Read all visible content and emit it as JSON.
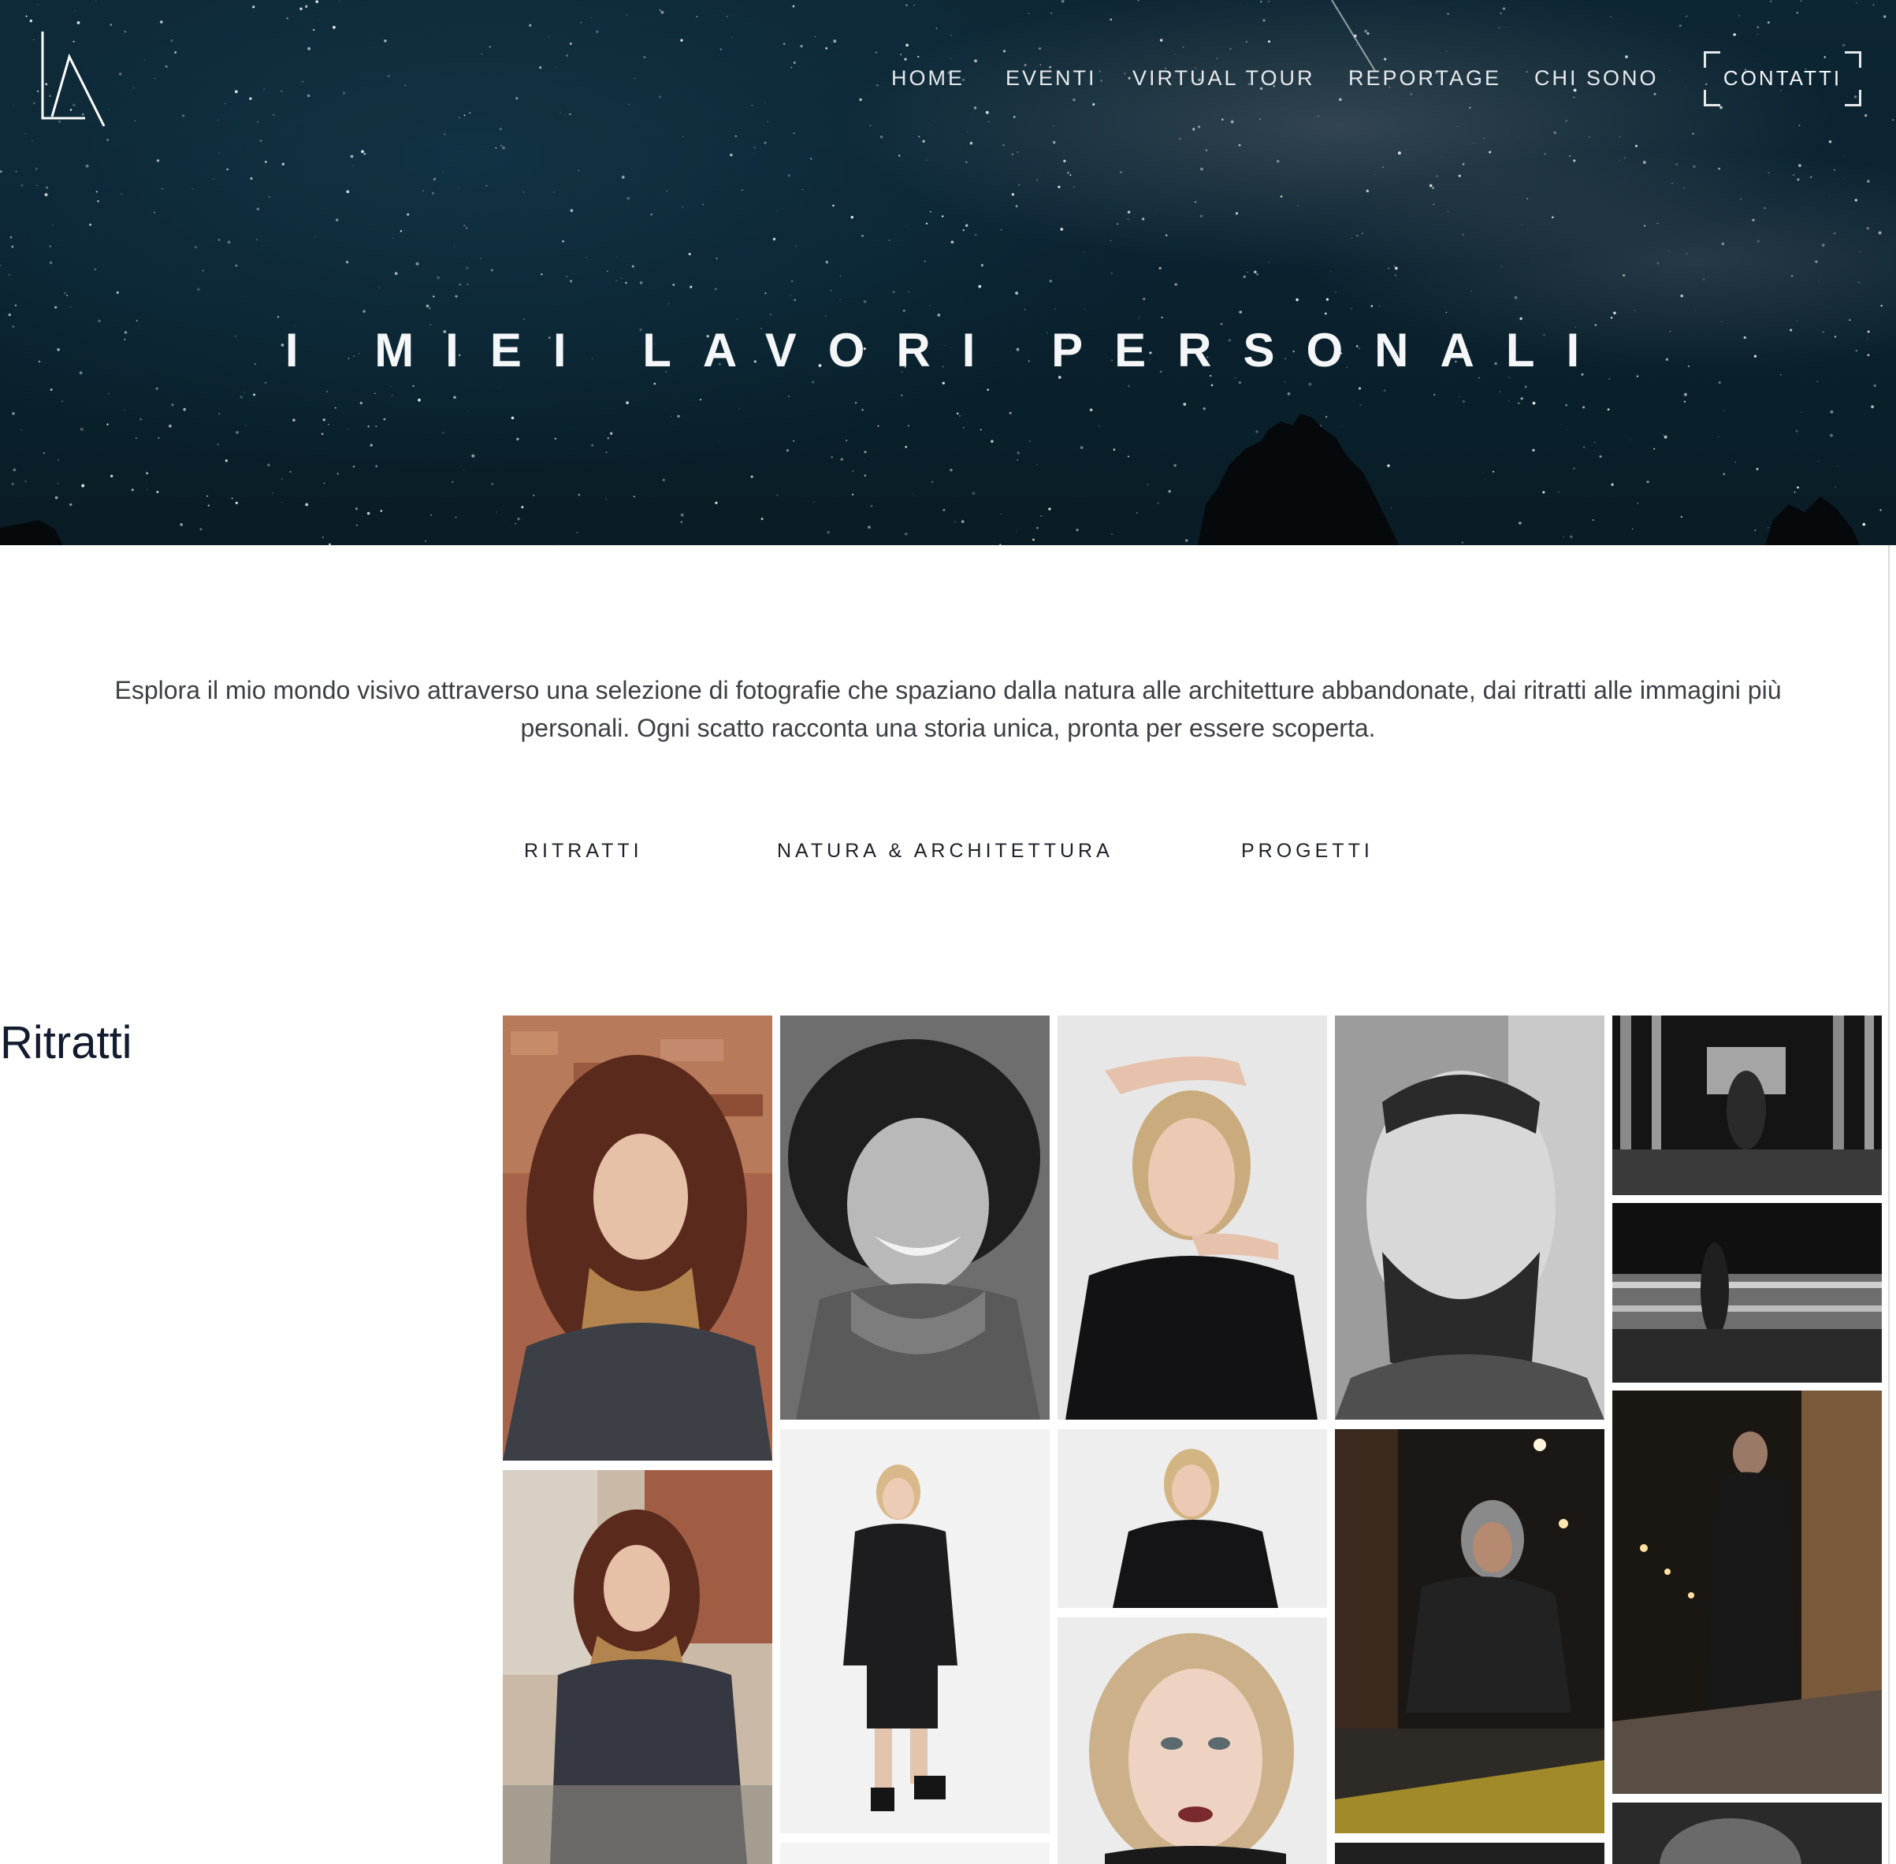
{
  "header": {
    "logo_alt": "LA",
    "nav": [
      {
        "label": "HOME"
      },
      {
        "label": "EVENTI"
      },
      {
        "label": "VIRTUAL TOUR"
      },
      {
        "label": "REPORTAGE"
      },
      {
        "label": "CHI SONO"
      }
    ],
    "contact_label": "CONTATTI"
  },
  "hero": {
    "title": "I MIEI LAVORI PERSONALI"
  },
  "intro": {
    "line1": "Esplora il mio mondo visivo attraverso una selezione di fotografie che spaziano dalla natura alle architetture abbandonate, dai ritratti alle immagini più",
    "line2": "personali. Ogni scatto racconta una storia unica, pronta per essere scoperta."
  },
  "filters": [
    {
      "label": "RITRATTI"
    },
    {
      "label": "NATURA & ARCHITETTURA"
    },
    {
      "label": "PROGETTI"
    }
  ],
  "gallery": {
    "title": "Ritratti"
  },
  "colors": {
    "hero_bg": "#0b2230",
    "nav_text": "#e6e9ec",
    "body_text": "#3c3f44",
    "section_title": "#121c2e"
  }
}
